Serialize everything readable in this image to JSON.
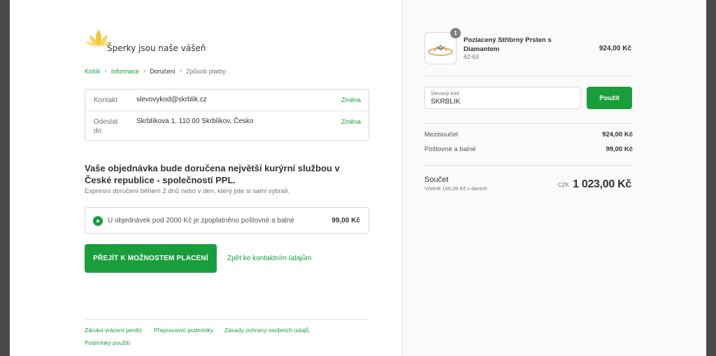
{
  "brand": {
    "name": "Šperky jsou naše vášeň",
    "accent": "#1a9e3c",
    "logo_color": "#f5c431"
  },
  "breadcrumb": [
    {
      "label": "Košík",
      "state": "link"
    },
    {
      "label": "Informace",
      "state": "link"
    },
    {
      "label": "Doručení",
      "state": "current"
    },
    {
      "label": "Způsob platby:",
      "state": "upcoming"
    }
  ],
  "review": {
    "contact": {
      "label": "Kontakt",
      "value": "slevovykod@skrblik.cz",
      "change": "Změna"
    },
    "ship_to": {
      "label": "Odeslat do",
      "value": "Skrblíkova 1, 110 00 Skrblíkov, Česko",
      "change": "Změna"
    }
  },
  "shipping": {
    "title": "Vaše objednávka bude doručena největší kurýrní službou v České republice - společností PPL.",
    "subtitle": "Expresní doručení během 2 dnů nebo v den, který jste si sami vybrali.",
    "option_label": "U objednávek pod 2000 Kč je zpoplatněno poštovné a balné",
    "option_price": "99,00 Kč"
  },
  "actions": {
    "continue_label": "PŘEJÍT K MOŽNOSTEM PLACENÍ",
    "back_label": "Zpět ke kontaktním údajům"
  },
  "footer_links": [
    "Záruka vrácení peněz",
    "Přepravavní podmínky",
    "Zásady ochrany osobních údajů",
    "Podmínky použití"
  ],
  "order": {
    "product": {
      "quantity": "1",
      "name": "Pozlacený Stříbrný Prsten s Diamantem",
      "variant": "62-63",
      "price": "924,00 Kč"
    },
    "discount": {
      "label": "Slevový kód",
      "value": "SKRBLÍK",
      "apply_label": "Použít"
    },
    "subtotal": {
      "label": "Mezisoučet",
      "value": "924,00 Kč"
    },
    "shipping": {
      "label": "Poštovné a balné",
      "value": "99,00 Kč"
    },
    "total": {
      "label": "Součet",
      "tax_note": "Včetně 160,36 Kč v daních",
      "currency": "CZK",
      "amount": "1 023,00 Kč"
    }
  }
}
